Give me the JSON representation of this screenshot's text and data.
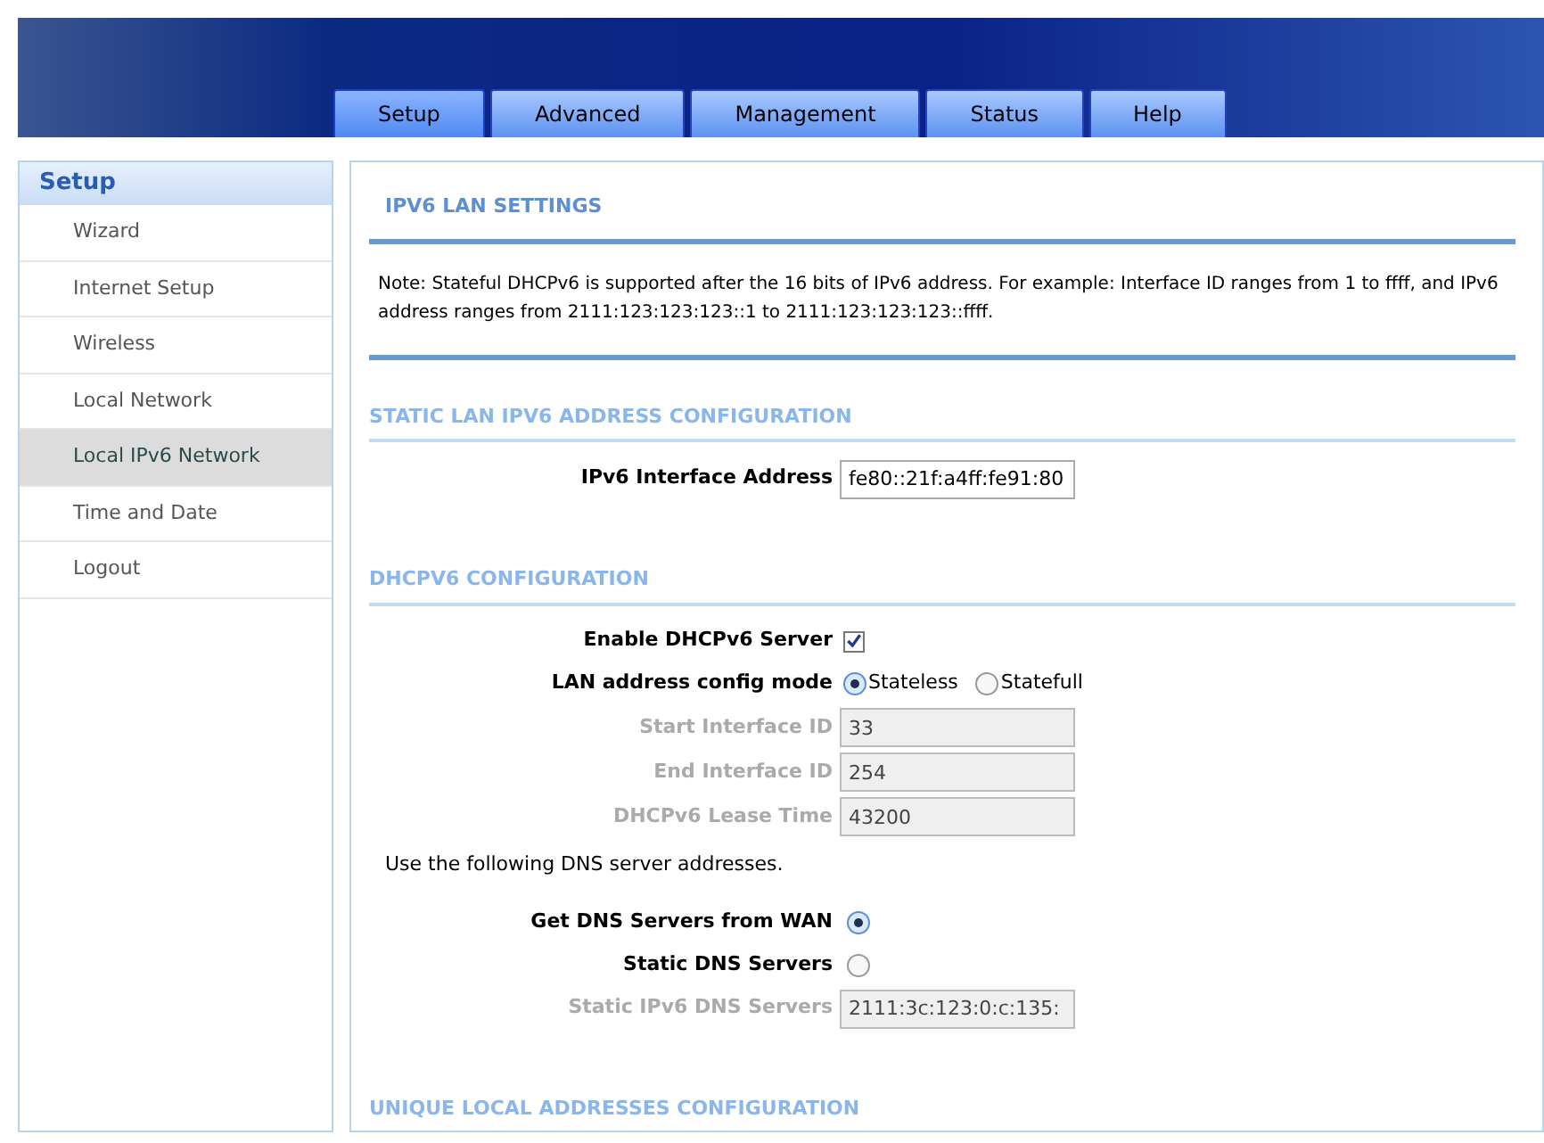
{
  "tabs": [
    {
      "label": "Setup",
      "selected": true
    },
    {
      "label": "Advanced",
      "selected": false
    },
    {
      "label": "Management",
      "selected": false
    },
    {
      "label": "Status",
      "selected": false
    },
    {
      "label": "Help",
      "selected": false
    }
  ],
  "sidebar": {
    "title": "Setup",
    "items": [
      {
        "label": "Wizard",
        "selected": false
      },
      {
        "label": "Internet Setup",
        "selected": false
      },
      {
        "label": "Wireless",
        "selected": false
      },
      {
        "label": "Local Network",
        "selected": false
      },
      {
        "label": "Local IPv6 Network",
        "selected": true
      },
      {
        "label": "Time and Date",
        "selected": false
      },
      {
        "label": "Logout",
        "selected": false
      }
    ]
  },
  "page_title": "IPV6 LAN SETTINGS",
  "note": "Note: Stateful DHCPv6 is supported after the 16 bits of IPv6 address. For example: Interface ID ranges from 1 to ffff, and IPv6 address ranges from 2111:123:123:123::1 to 2111:123:123:123::ffff.",
  "sections": [
    {
      "title": "STATIC LAN IPV6 ADDRESS CONFIGURATION",
      "rows": [
        {
          "kind": "input",
          "label": "IPv6 Interface Address",
          "value": "fe80::21f:a4ff:fe91:80",
          "disabled": false
        }
      ]
    },
    {
      "title": "DHCPV6 CONFIGURATION",
      "rows": [
        {
          "kind": "checkbox",
          "label": "Enable DHCPv6 Server",
          "checked": true
        },
        {
          "kind": "radios",
          "label": "LAN address config mode",
          "options": [
            {
              "label": "Stateless",
              "selected": true
            },
            {
              "label": "Statefull",
              "selected": false
            }
          ]
        },
        {
          "kind": "input",
          "label": "Start Interface ID",
          "value": "33",
          "disabled": true
        },
        {
          "kind": "input",
          "label": "End Interface ID",
          "value": "254",
          "disabled": true
        },
        {
          "kind": "input",
          "label": "DHCPv6 Lease Time",
          "value": "43200",
          "disabled": true
        },
        {
          "kind": "text",
          "text": "Use the following DNS server addresses."
        },
        {
          "kind": "radio",
          "label": "Get DNS Servers from WAN",
          "selected": true
        },
        {
          "kind": "radio",
          "label": "Static DNS Servers",
          "selected": false
        },
        {
          "kind": "input",
          "label": "Static IPv6 DNS Servers",
          "value": "2111:3c:123:0:c:135:",
          "disabled": true
        }
      ]
    },
    {
      "title": "UNIQUE LOCAL ADDRESSES CONFIGURATION"
    }
  ]
}
